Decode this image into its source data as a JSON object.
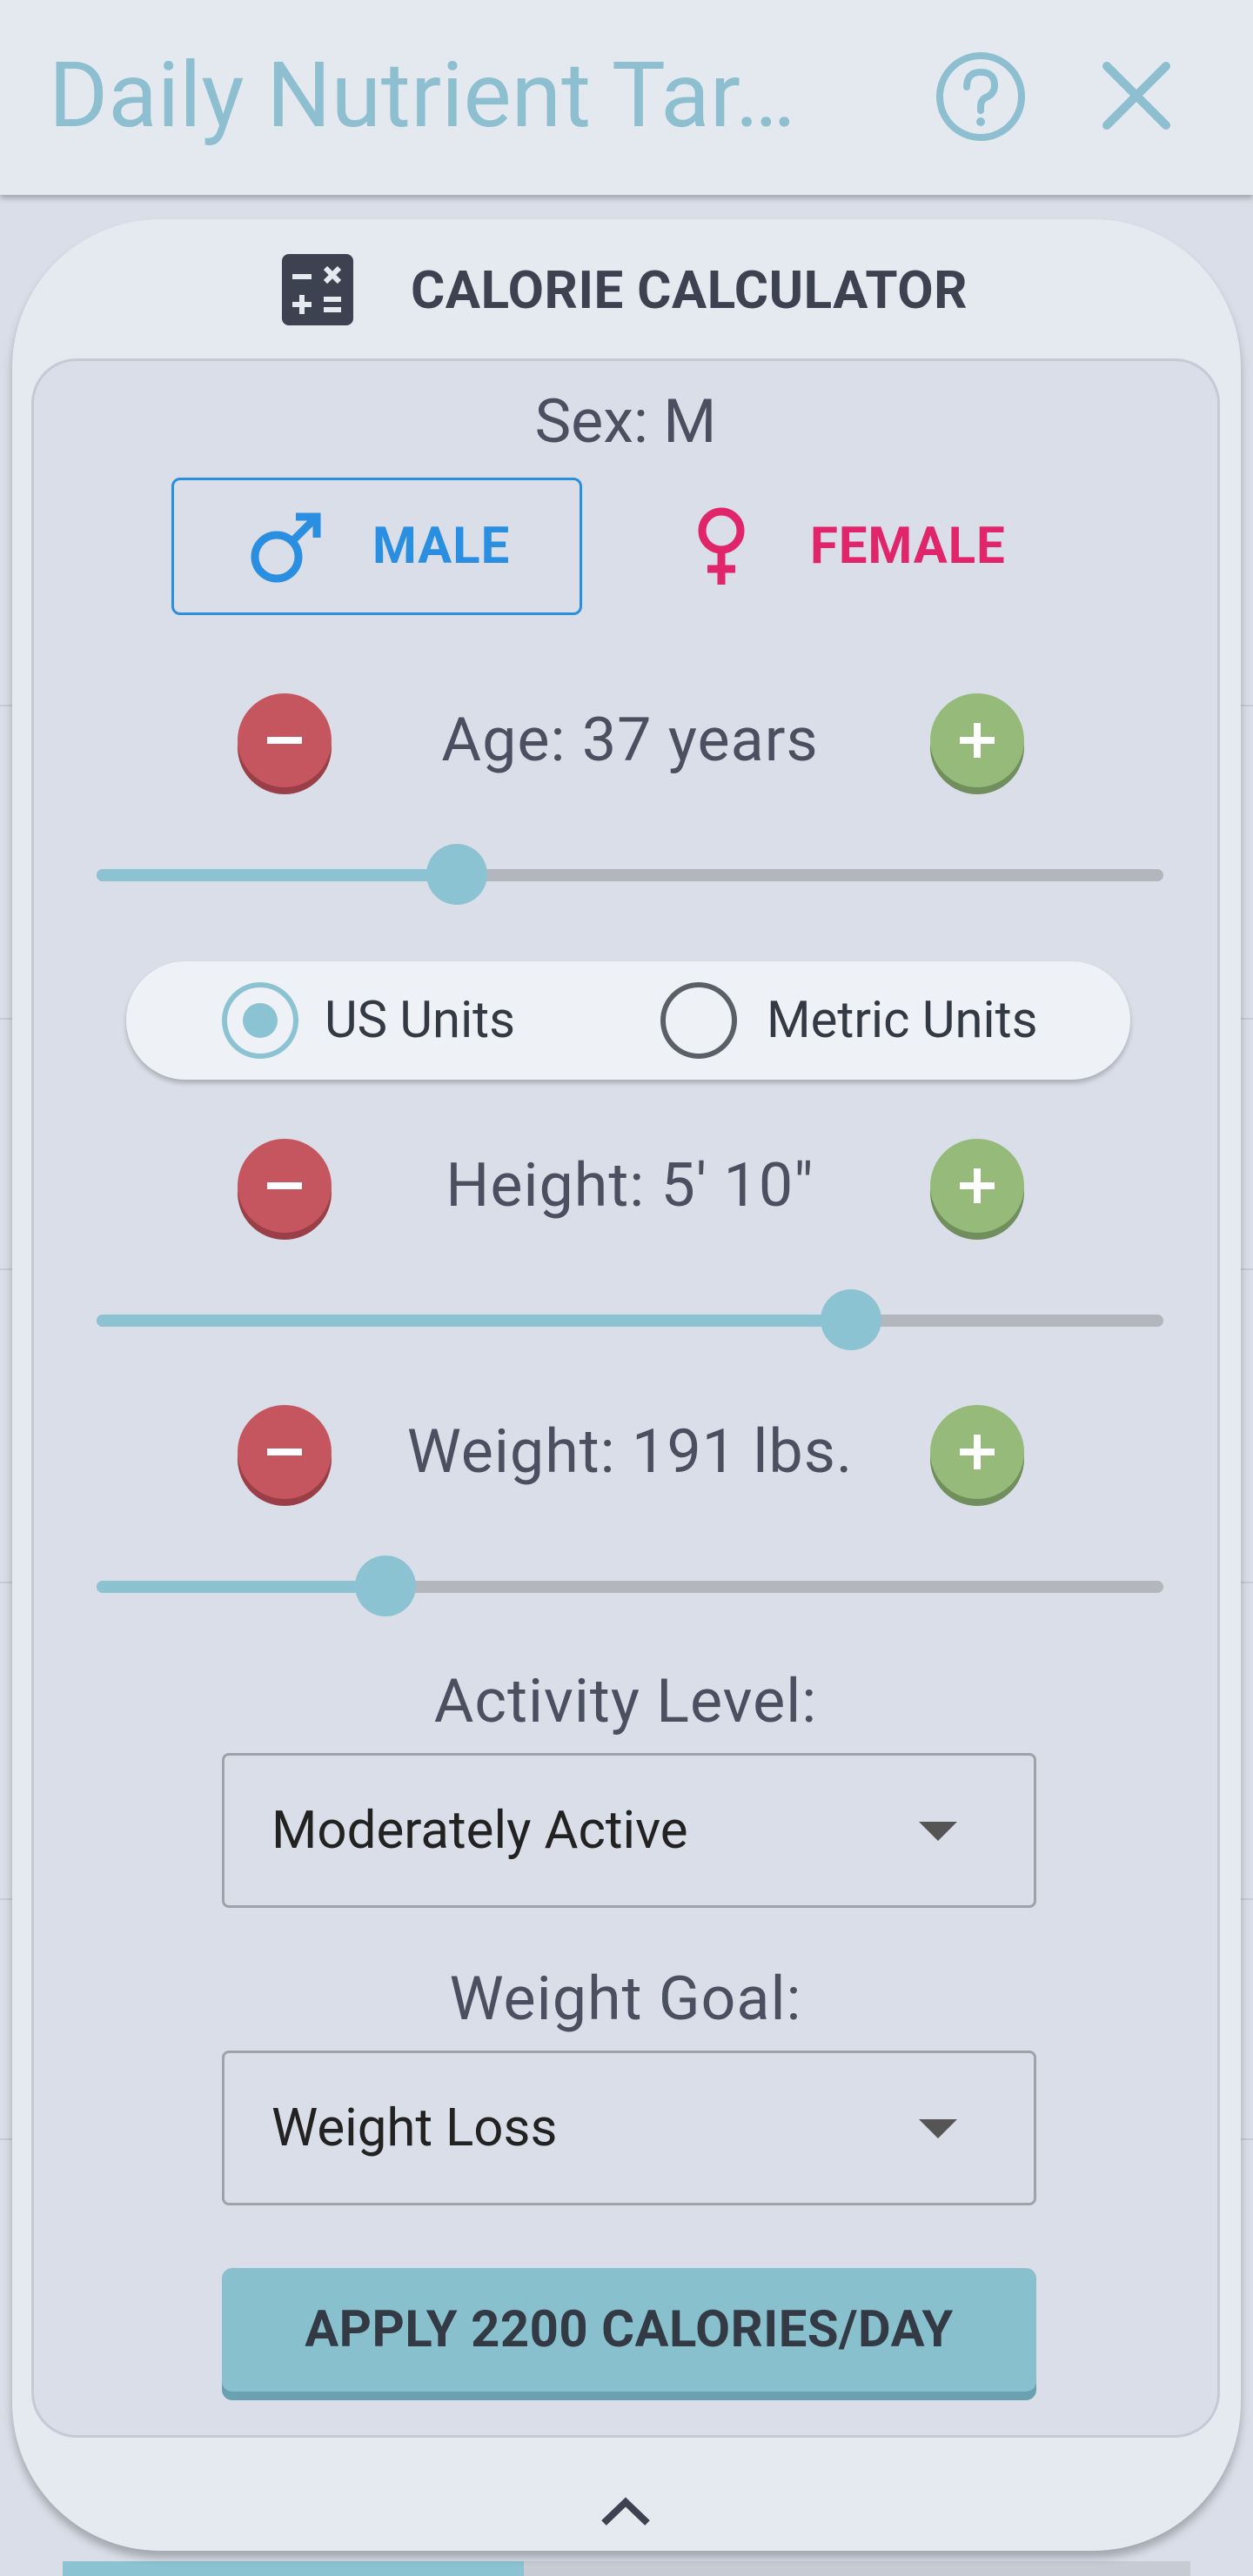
{
  "header": {
    "title": "Daily Nutrient Tar…"
  },
  "calculator": {
    "title": "CALORIE CALCULATOR",
    "sex_label": "Sex: M",
    "sex_options": {
      "male": "MALE",
      "female": "FEMALE",
      "selected": "male"
    },
    "age": {
      "label": "Age: 37 years",
      "slider_fraction": 0.338
    },
    "units": {
      "us": "US Units",
      "metric": "Metric Units",
      "selected": "us"
    },
    "height": {
      "label": "Height: 5' 10\"",
      "slider_fraction": 0.707
    },
    "weight": {
      "label": "Weight: 191 lbs.",
      "slider_fraction": 0.271
    },
    "activity": {
      "label": "Activity Level:",
      "value": "Moderately Active"
    },
    "goal": {
      "label": "Weight Goal:",
      "value": "Weight Loss"
    },
    "apply_label": "APPLY 2200 CALORIES/DAY"
  },
  "colors": {
    "accent": "#8bc3d2",
    "male": "#2a8fe0",
    "female": "#e0256b",
    "minus": "#c5555f",
    "plus": "#95ba7a"
  },
  "icons": {
    "help": "help-circle-icon",
    "close": "close-icon",
    "calculator": "calculator-icon",
    "male": "male-symbol-icon",
    "female": "female-symbol-icon",
    "minus": "minus-icon",
    "plus": "plus-icon",
    "dropdown": "caret-down-icon",
    "collapse": "chevron-up-icon"
  }
}
